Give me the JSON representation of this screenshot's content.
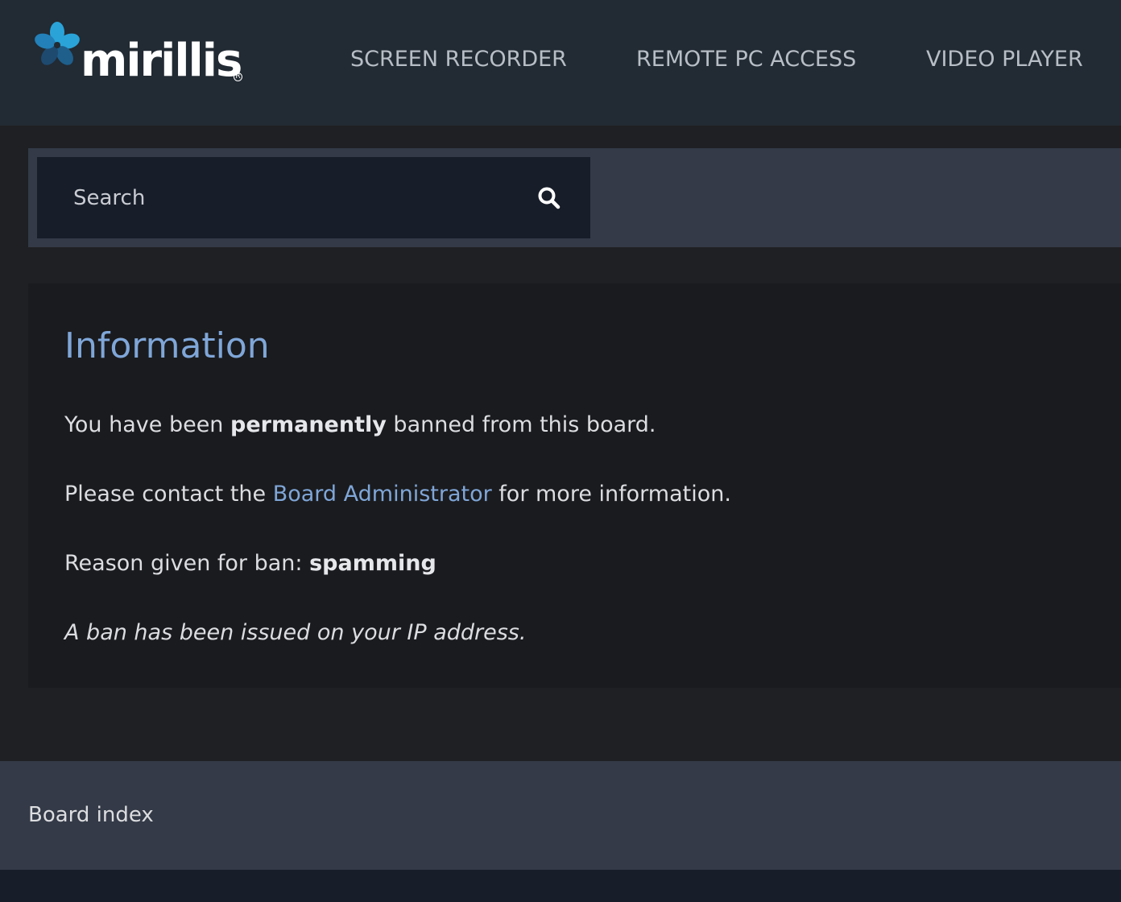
{
  "header": {
    "logo_text": "mirillis",
    "logo_reg": "R",
    "nav": [
      {
        "label": "SCREEN RECORDER"
      },
      {
        "label": "REMOTE PC ACCESS"
      },
      {
        "label": "VIDEO PLAYER"
      }
    ]
  },
  "search": {
    "placeholder": "Search",
    "icon": "search-icon"
  },
  "message": {
    "title": "Information",
    "line1_pre": "You have been ",
    "line1_bold": "permanently",
    "line1_post": " banned from this board.",
    "line2_pre": "Please contact the ",
    "line2_link": "Board Administrator",
    "line2_post": " for more information.",
    "line3_pre": "Reason given for ban: ",
    "line3_bold": "spamming",
    "line4": "A ban has been issued on your IP address."
  },
  "footer": {
    "board_index": "Board index"
  },
  "colors": {
    "header_bg": "#222a33",
    "link": "#7fa6d8",
    "search_band": "#343a47",
    "search_box": "#171d29"
  }
}
